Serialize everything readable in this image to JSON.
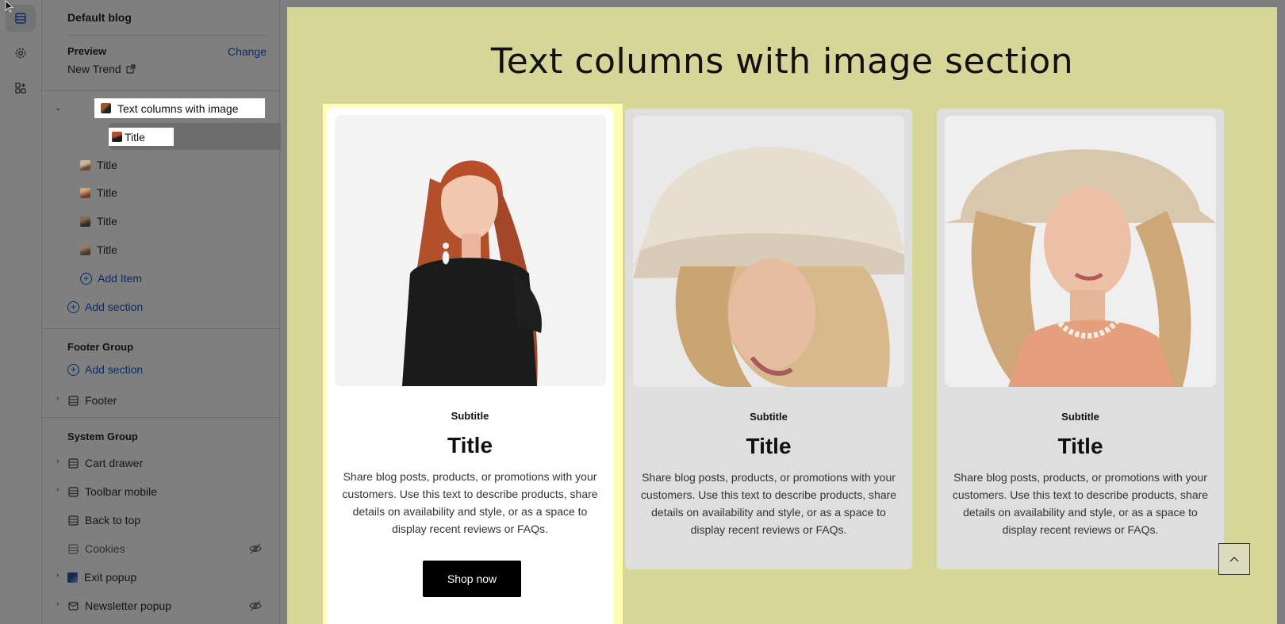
{
  "sidebar": {
    "store_title": "Default blog",
    "preview_label": "Preview",
    "change_label": "Change",
    "preview_value": "New Trend",
    "section": {
      "name": "Text columns with image",
      "items": [
        "Title",
        "Title",
        "Title",
        "Title",
        "Title"
      ],
      "add_item_label": "Add Item"
    },
    "add_section_label": "Add section",
    "footer_group": {
      "title": "Footer Group",
      "add_section_label": "Add section",
      "items": [
        "Footer"
      ]
    },
    "system_group": {
      "title": "System Group",
      "items": [
        "Cart drawer",
        "Toolbar mobile",
        "Back to top",
        "Cookies",
        "Exit popup",
        "Newsletter popup"
      ]
    }
  },
  "preview": {
    "section_heading": "Text columns with image section",
    "cards": [
      {
        "subtitle": "Subtitle",
        "title": "Title",
        "description": "Share blog posts, products, or promotions with your customers. Use this text to describe products, share details on availability and style, or as a space to display recent reviews or FAQs.",
        "button": "Shop now",
        "image_alt": "woman in black dress"
      },
      {
        "subtitle": "Subtitle",
        "title": "Title",
        "description": "Share blog posts, products, or promotions with your customers. Use this text to describe products, share details on availability and style, or as a space to display recent reviews or FAQs.",
        "image_alt": "woman in bucket hat"
      },
      {
        "subtitle": "Subtitle",
        "title": "Title",
        "description": "Share blog posts, products, or promotions with your customers. Use this text to describe products, share details on availability and style, or as a space to display recent reviews or FAQs.",
        "image_alt": "woman with shell necklace"
      }
    ]
  },
  "colors": {
    "link": "#0a2a66",
    "page_background": "#d5d697",
    "highlight": "#fffeb0"
  }
}
